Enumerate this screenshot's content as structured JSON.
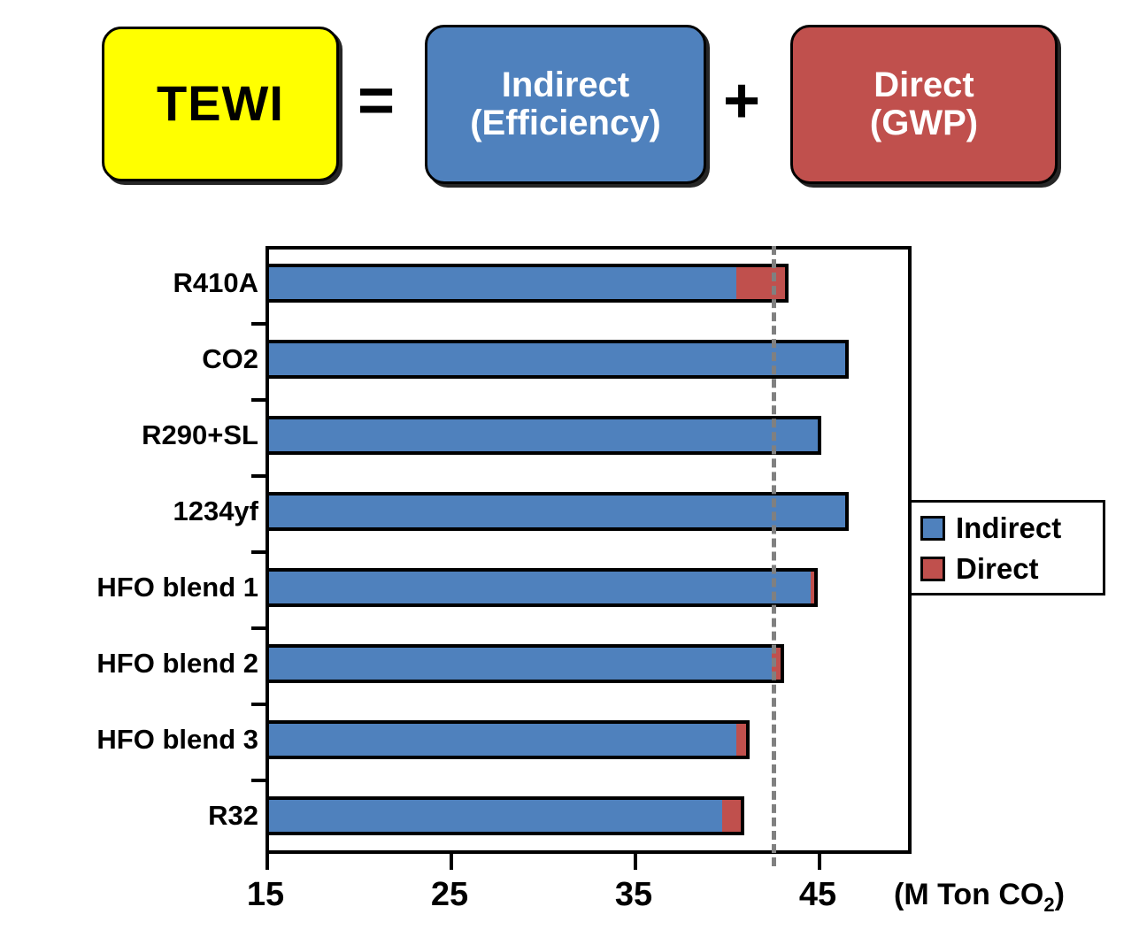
{
  "equation": {
    "tewi_label": "TEWI",
    "equals_symbol": "=",
    "indirect_label": "Indirect\n(Efficiency)",
    "indirect_line1": "Indirect",
    "indirect_line2": "(Efficiency)",
    "plus_symbol": "+",
    "direct_line1": "Direct",
    "direct_line2": "(GWP)",
    "colors": {
      "tewi_bg": "#ffff00",
      "indirect_bg": "#4f81bd",
      "direct_bg": "#c0504d",
      "text_dark": "#000000",
      "text_light": "#ffffff"
    }
  },
  "legend": {
    "items": [
      {
        "label": "Indirect",
        "color": "#4f81bd"
      },
      {
        "label": "Direct",
        "color": "#c0504d"
      }
    ]
  },
  "chart_data": {
    "type": "bar",
    "orientation": "horizontal",
    "stacked": true,
    "title": "",
    "xlabel": "(M Ton CO2)",
    "xlabel_prefix": "(M Ton CO",
    "xlabel_sub": "2",
    "xlabel_suffix": ")",
    "ylabel": "",
    "categories": [
      "R410A",
      "CO2",
      "R290+SL",
      "1234yf",
      "HFO blend 1",
      "HFO blend 2",
      "HFO blend 3",
      "R32"
    ],
    "series": [
      {
        "name": "Indirect",
        "color": "#4f81bd",
        "values": [
          40.6,
          46.7,
          45.2,
          46.7,
          44.6,
          42.5,
          40.6,
          39.8
        ]
      },
      {
        "name": "Direct",
        "color": "#c0504d",
        "values": [
          2.6,
          0.0,
          0.0,
          0.0,
          0.2,
          0.5,
          0.5,
          1.0
        ]
      }
    ],
    "totals": [
      43.2,
      46.7,
      45.2,
      46.7,
      44.8,
      43.0,
      41.1,
      40.8
    ],
    "xlim": [
      15,
      50
    ],
    "xticks": [
      15,
      25,
      35,
      45
    ],
    "xtick_labels": [
      "15",
      "25",
      "35",
      "45"
    ],
    "grid": false,
    "legend_position": "right",
    "annotations": [
      {
        "type": "reference-line",
        "orientation": "vertical",
        "value": 42.5,
        "style": "dashed",
        "color": "#808080"
      }
    ]
  }
}
